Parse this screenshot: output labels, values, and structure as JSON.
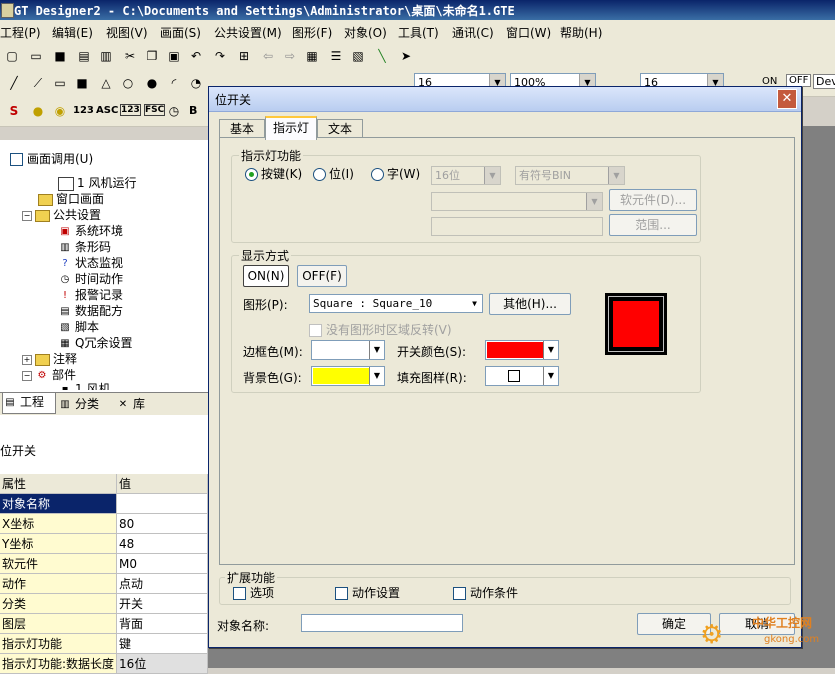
{
  "app": {
    "title": "GT Designer2 - C:\\Documents and Settings\\Administrator\\桌面\\未命名1.GTE"
  },
  "menu": [
    "工程(P)",
    "编辑(E)",
    "视图(V)",
    "画面(S)",
    "公共设置(M)",
    "图形(F)",
    "对象(O)",
    "工具(T)",
    "通讯(C)",
    "窗口(W)",
    "帮助(H)"
  ],
  "toolbar": {
    "zoom": "100%",
    "size1": "16",
    "size2": "16",
    "on_label": "ON",
    "off_label": "OFF",
    "dev_label": "Dev",
    "text_123": "123",
    "text_asc": "ASC",
    "text_fsc": "FSC",
    "text_b": "B"
  },
  "left": {
    "screen_call": "画面调用(U)",
    "tree": [
      "1 风机运行",
      "窗口画面",
      "公共设置",
      "系统环境",
      "条形码",
      "状态监视",
      "时间动作",
      "报警记录",
      "数据配方",
      "脚本",
      "Q冗余设置",
      "注释",
      "部件",
      "1 风机"
    ],
    "tabs": [
      "工程",
      "分类",
      "库"
    ],
    "panel_title": "位开关",
    "prop_headers": [
      "属性",
      "值"
    ],
    "props": [
      [
        "对象名称",
        ""
      ],
      [
        "X坐标",
        "80"
      ],
      [
        "Y坐标",
        "48"
      ],
      [
        "软元件",
        "M0"
      ],
      [
        "动作",
        "点动"
      ],
      [
        "分类",
        "开关"
      ],
      [
        "图层",
        "背面"
      ],
      [
        "指示灯功能",
        "键"
      ],
      [
        "指示灯功能:数据长度",
        "16位"
      ]
    ]
  },
  "dialog": {
    "title": "位开关",
    "tabs": [
      "基本",
      "指示灯",
      "文本"
    ],
    "indicator_group": "指示灯功能",
    "radio_key": "按键(K)",
    "radio_bit": "位(I)",
    "radio_word": "字(W)",
    "bits": "16位",
    "datatype": "有符号BIN",
    "device_button": "软元件(D)...",
    "range_button": "范围...",
    "display_group": "显示方式",
    "on_button": "ON(N)",
    "off_button": "OFF(F)",
    "shape_label": "图形(P):",
    "shape_value": "Square : Square_10",
    "other_button": "其他(H)...",
    "reverse_check": "没有图形时区域反转(V)",
    "frame_color_label": "边框色(M):",
    "switch_color_label": "开关颜色(S):",
    "bg_color_label": "背景色(G):",
    "fill_pattern_label": "填充图样(R):",
    "colors": {
      "frame": "#ffffff",
      "switch": "#ff0000",
      "bg": "#ffff00"
    },
    "ext_group": "扩展功能",
    "ext_options": "选项",
    "ext_action": "动作设置",
    "ext_condition": "动作条件",
    "object_name_label": "对象名称:",
    "ok_button": "确定",
    "cancel_button": "取消"
  },
  "watermark": {
    "text": "中华工控网",
    "url": "gkong.com"
  }
}
